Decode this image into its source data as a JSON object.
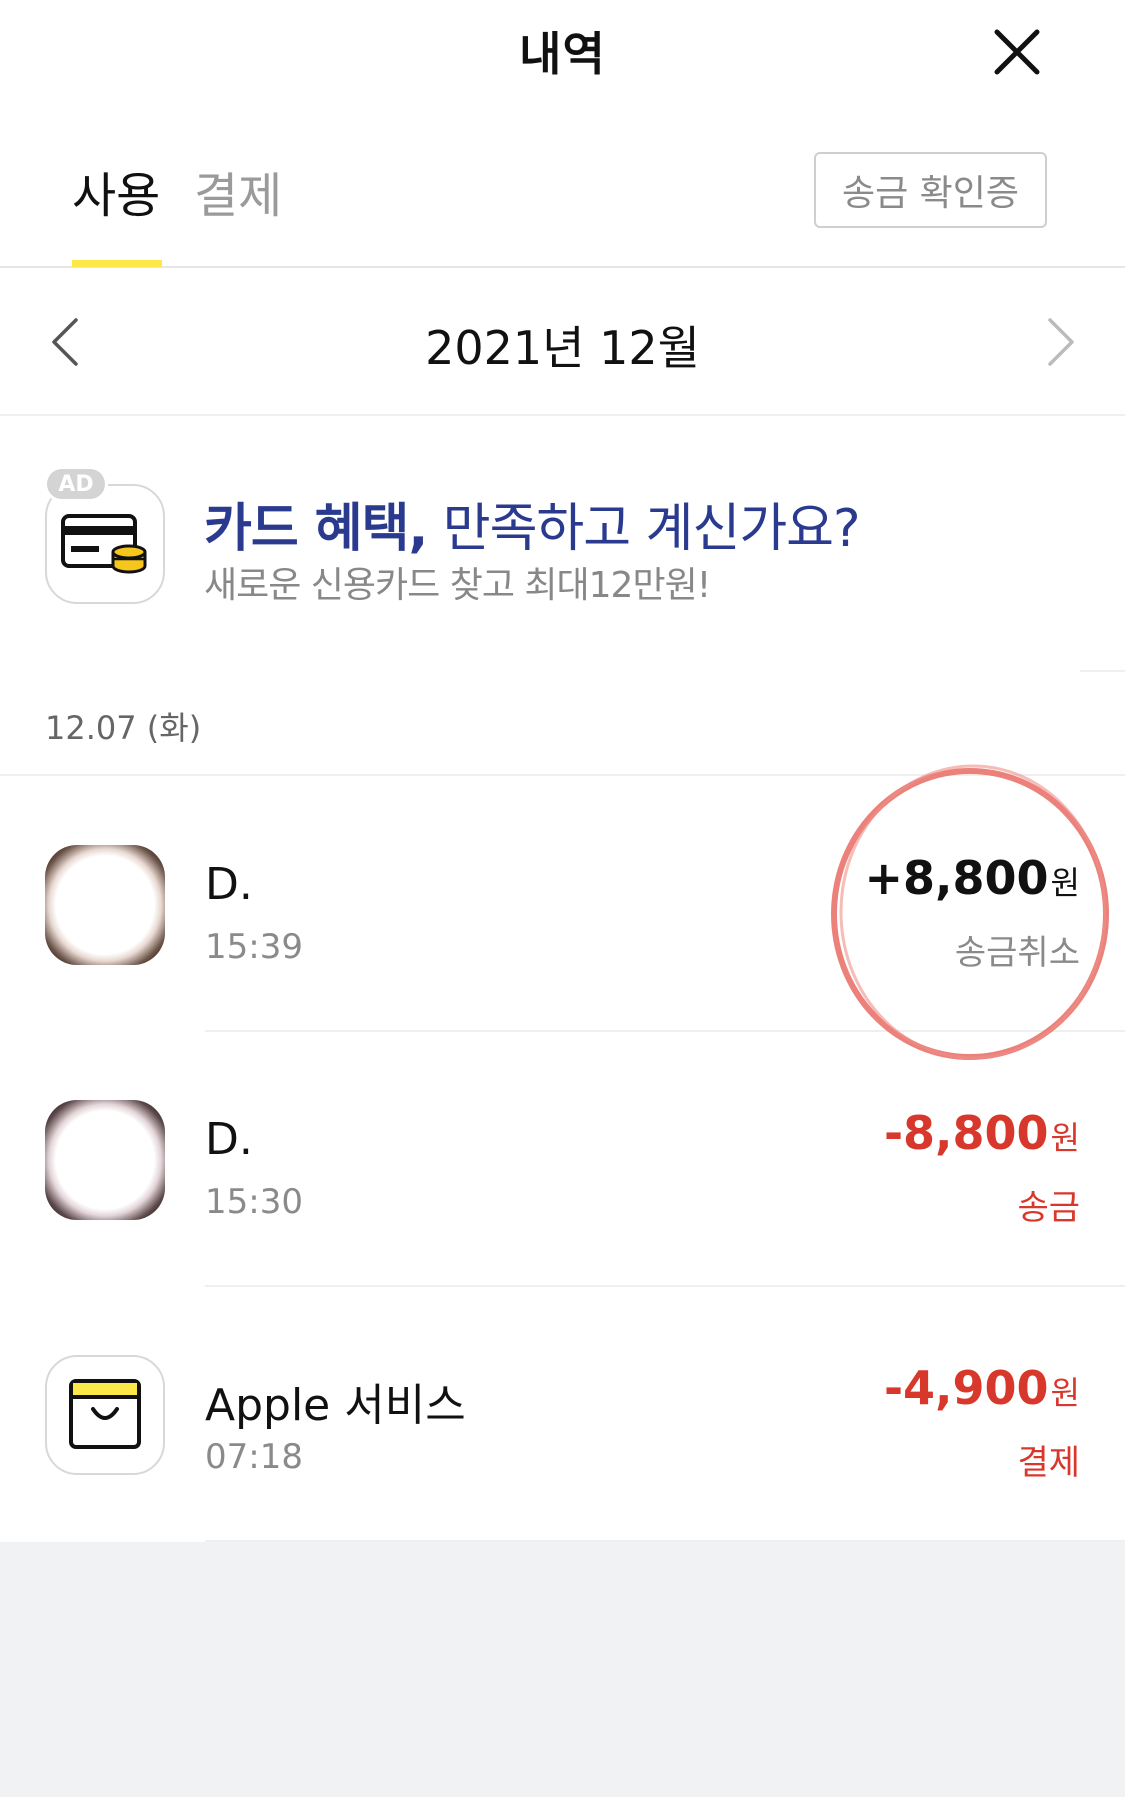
{
  "header": {
    "title": "내역",
    "close_icon": "close-icon"
  },
  "tabs": [
    {
      "label": "사용",
      "active": true
    },
    {
      "label": "결제",
      "active": false
    }
  ],
  "confirm_button": {
    "label": "송금 확인증"
  },
  "month": {
    "label": "2021년 12월",
    "prev_icon": "chevron-left-icon",
    "next_icon": "chevron-right-icon"
  },
  "ad": {
    "badge": "AD",
    "headline_bold": "카드 혜택,",
    "headline_rest": " 만족하고 계신가요?",
    "subtitle": "새로운 신용카드 찾고 최대12만원!",
    "icon": "credit-card-coins-icon"
  },
  "date_group": {
    "label": "12.07 (화)"
  },
  "transactions": [
    {
      "name": "D.",
      "time": "15:39",
      "amount": "+8,800",
      "unit": "원",
      "status": "송금취소",
      "type": "positive",
      "icon": "profile-avatar-icon",
      "highlighted": true
    },
    {
      "name": "D.",
      "time": "15:30",
      "amount": "-8,800",
      "unit": "원",
      "status": "송금",
      "type": "negative",
      "icon": "profile-avatar-icon",
      "highlighted": false
    },
    {
      "name": "Apple 서비스",
      "time": "07:18",
      "amount": "-4,900",
      "unit": "원",
      "status": "결제",
      "type": "negative",
      "icon": "shopping-bag-icon",
      "highlighted": false
    }
  ],
  "colors": {
    "accent_yellow": "#fde84a",
    "negative_red": "#d8372c",
    "ad_blue": "#2a3a8e",
    "highlight_circle": "#e9736b",
    "bottom_gray": "#f1f2f4"
  }
}
